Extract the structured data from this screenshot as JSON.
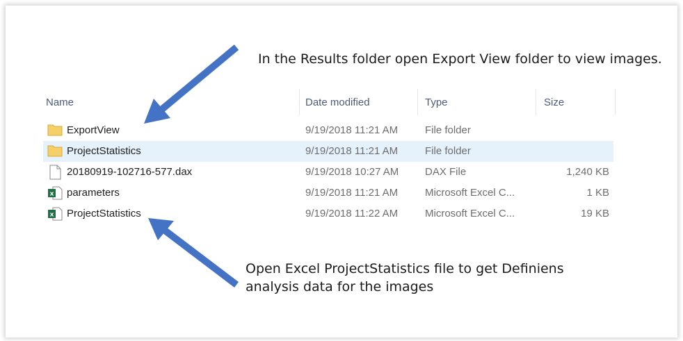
{
  "callouts": {
    "top": "In the Results folder open Export View folder to view images.",
    "bottom": "Open Excel ProjectStatistics file to get Definiens analysis data for the images"
  },
  "columns": {
    "name": "Name",
    "date": "Date modified",
    "type": "Type",
    "size": "Size"
  },
  "files": [
    {
      "name": "ExportView",
      "date": "9/19/2018 11:21 AM",
      "type": "File folder",
      "size": "",
      "icon": "folder-icon",
      "selected": false
    },
    {
      "name": "ProjectStatistics",
      "date": "9/19/2018 11:21 AM",
      "type": "File folder",
      "size": "",
      "icon": "folder-icon",
      "selected": true
    },
    {
      "name": "20180919-102716-577.dax",
      "date": "9/19/2018 10:27 AM",
      "type": "DAX File",
      "size": "1,240 KB",
      "icon": "file-icon",
      "selected": false
    },
    {
      "name": "parameters",
      "date": "9/19/2018 11:21 AM",
      "type": "Microsoft Excel C...",
      "size": "1 KB",
      "icon": "excel-csv-icon",
      "selected": false
    },
    {
      "name": "ProjectStatistics",
      "date": "9/19/2018 11:22 AM",
      "type": "Microsoft Excel C...",
      "size": "19 KB",
      "icon": "excel-csv-icon",
      "selected": false
    }
  ],
  "colors": {
    "arrow": "#4472c4",
    "selection": "#e5f1fb",
    "folder": "#f5cf68",
    "excel": "#1e7145"
  }
}
